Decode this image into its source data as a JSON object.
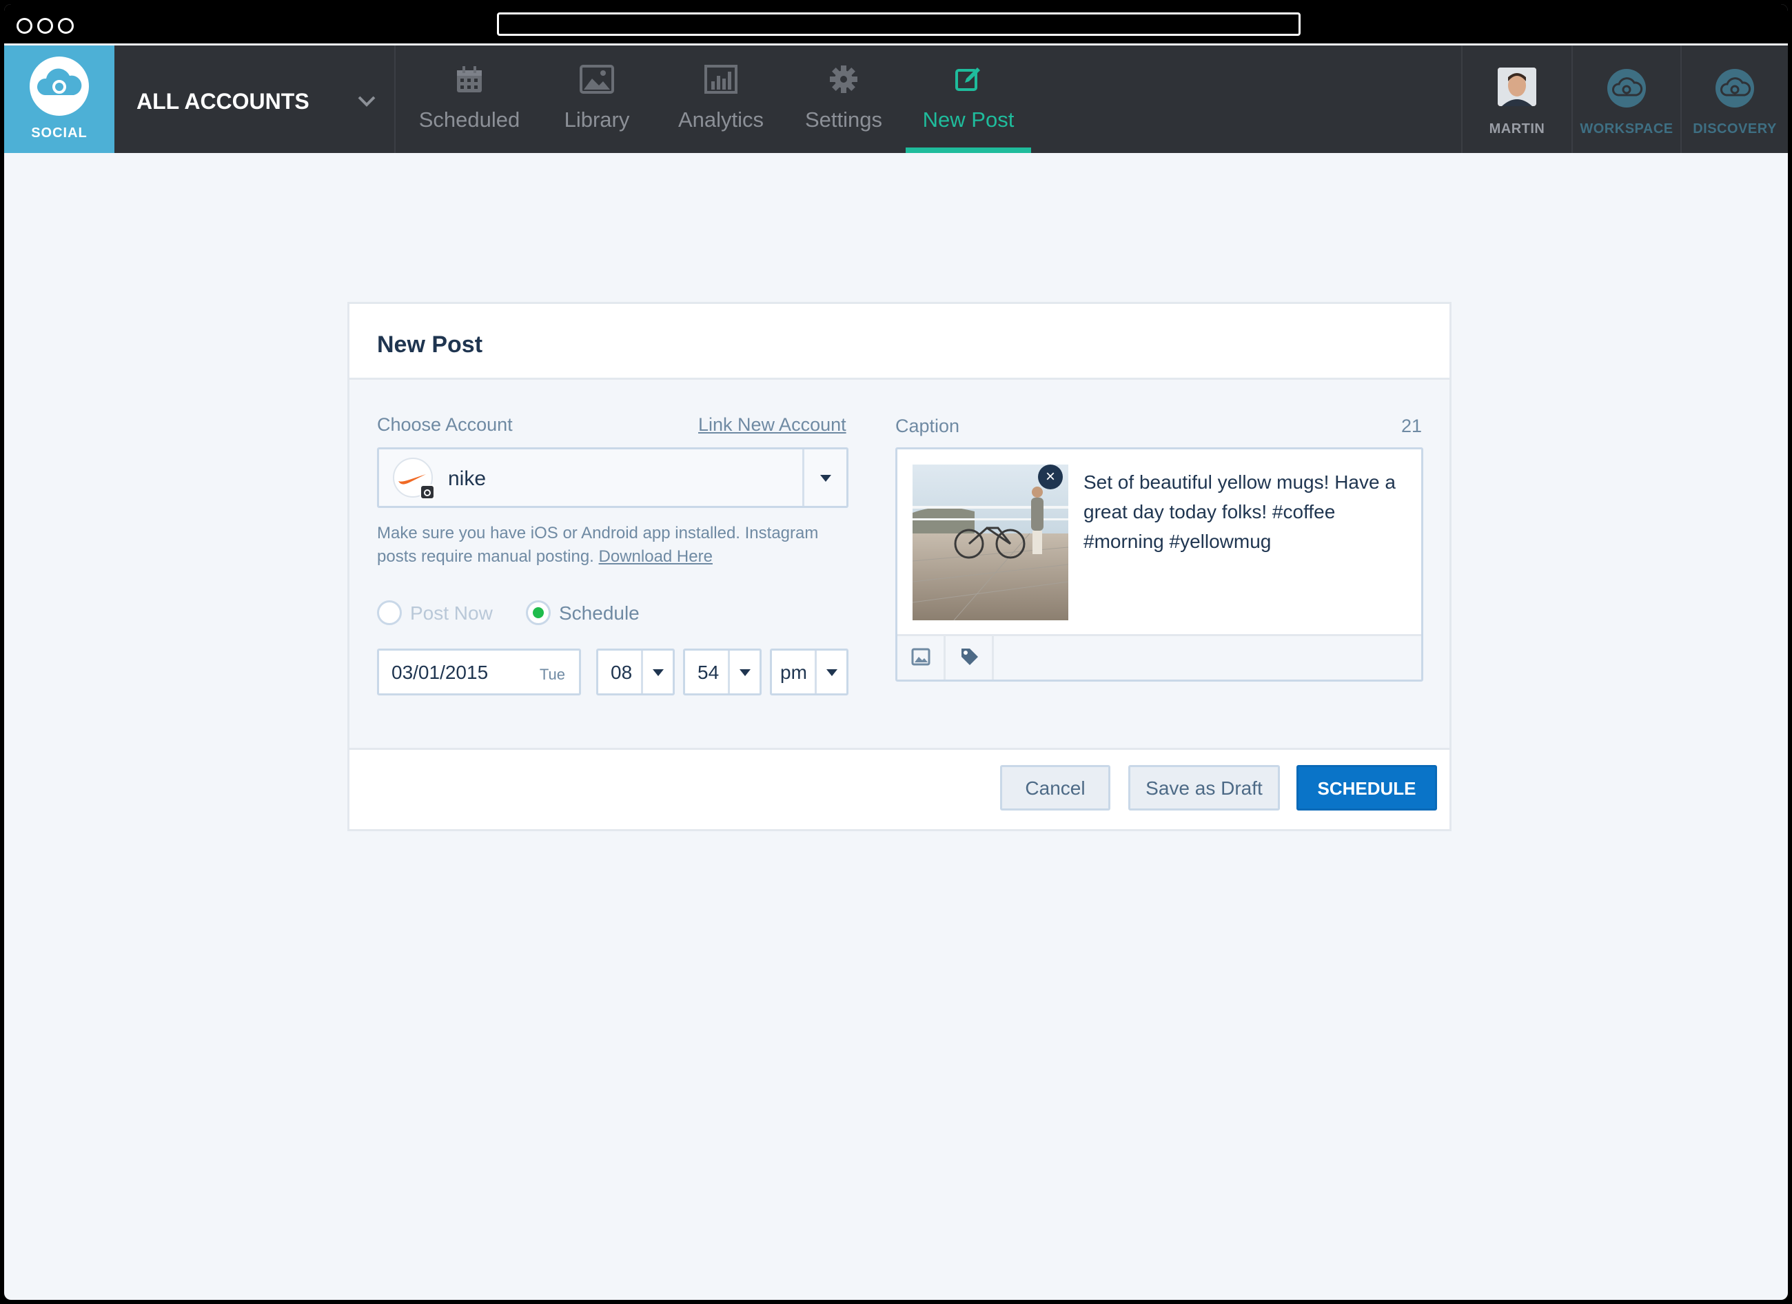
{
  "nav": {
    "brand": "SOCIAL",
    "account_selector": "ALL ACCOUNTS",
    "tabs": [
      {
        "label": "Scheduled",
        "icon": "calendar-icon"
      },
      {
        "label": "Library",
        "icon": "image-icon"
      },
      {
        "label": "Analytics",
        "icon": "bar-chart-icon"
      },
      {
        "label": "Settings",
        "icon": "gear-icon"
      },
      {
        "label": "New Post",
        "icon": "edit-icon",
        "active": true
      }
    ],
    "user": "MARTIN",
    "workspace": "WORKSPACE",
    "discovery": "DISCOVERY"
  },
  "form": {
    "title": "New Post",
    "choose_account_label": "Choose Account",
    "link_new_account": "Link New Account",
    "selected_account": "nike",
    "note_text": "Make sure you have iOS or Android app installed. Instagram posts require manual posting.",
    "download_link": "Download Here",
    "post_now_label": "Post Now",
    "schedule_label": "Schedule",
    "schedule_selected": true,
    "date": "03/01/2015",
    "day": "Tue",
    "hour": "08",
    "minute": "54",
    "ampm": "pm",
    "caption_label": "Caption",
    "caption_count": "21",
    "caption_text": "Set of beautiful yellow mugs! Have a great day today folks! #coffee #morning #yellowmug",
    "cancel_label": "Cancel",
    "draft_label": "Save as Draft",
    "schedule_button": "SCHEDULE"
  },
  "colors": {
    "accent": "#1fbc9c",
    "brand": "#4db0d6",
    "primary_button": "#0a74c8",
    "nav_bg": "#2f3237"
  }
}
